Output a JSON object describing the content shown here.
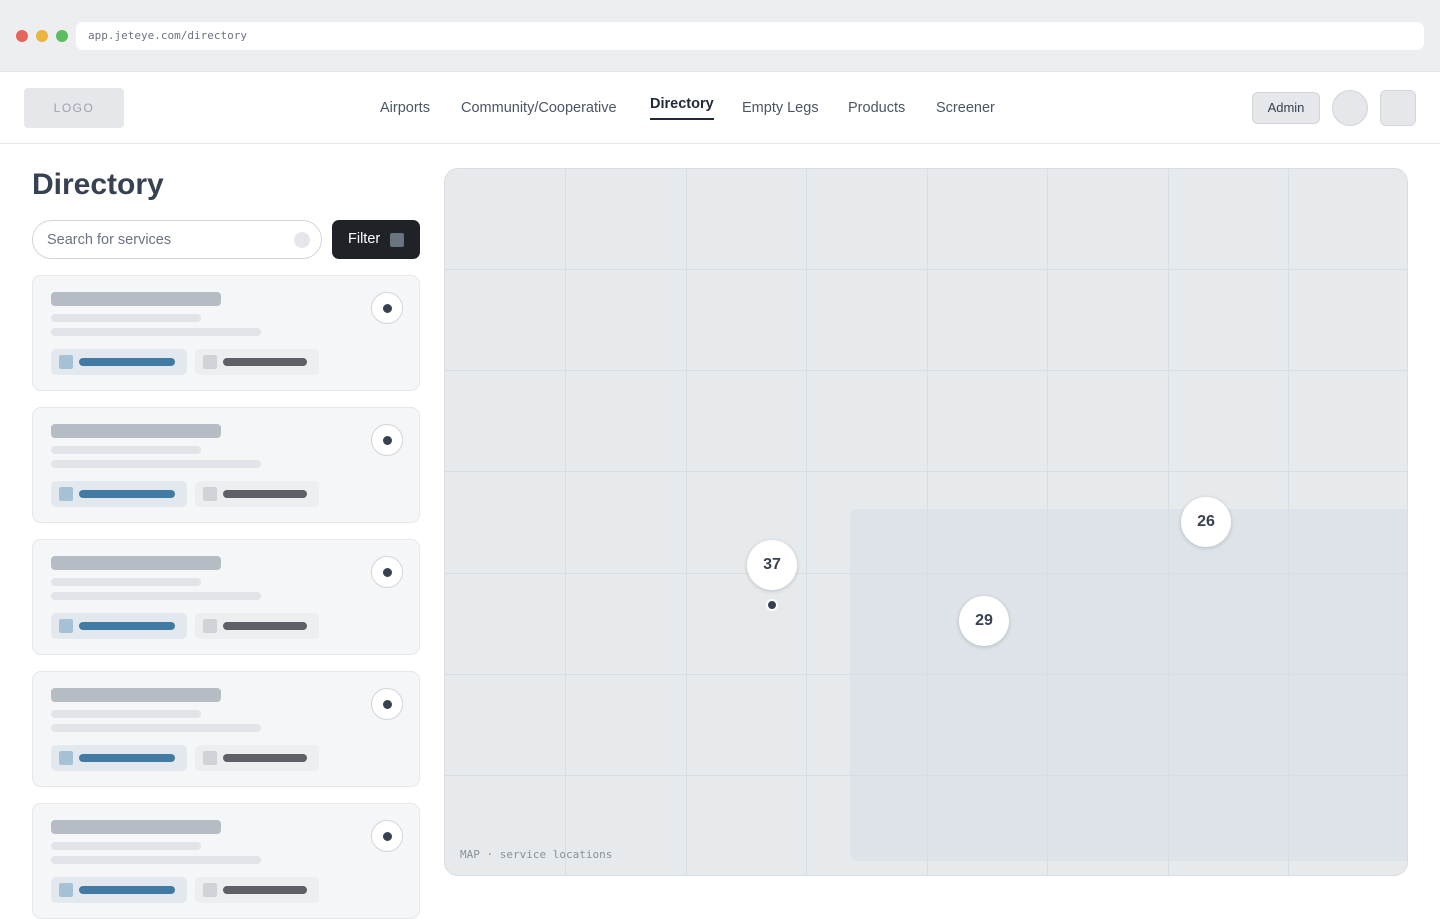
{
  "browser": {
    "url": "app.jeteye.com/directory"
  },
  "header": {
    "logo_text": "LOGO",
    "nav": [
      {
        "label": "Airports",
        "active": false
      },
      {
        "label": "Community/Cooperative",
        "active": false
      },
      {
        "label": "Directory",
        "active": true
      },
      {
        "label": "Empty Legs",
        "active": false
      },
      {
        "label": "Products",
        "active": false
      },
      {
        "label": "Screener",
        "active": false
      }
    ],
    "admin_label": "Admin"
  },
  "page": {
    "title": "Directory"
  },
  "search": {
    "placeholder": "Search for services",
    "filter_label": "Filter"
  },
  "cards": [
    {
      "state": "loading"
    },
    {
      "state": "loading"
    },
    {
      "state": "loading"
    },
    {
      "state": "loading"
    },
    {
      "state": "loading"
    }
  ],
  "map": {
    "caption": "MAP · service locations",
    "clusters": [
      {
        "count": "37"
      },
      {
        "count": "26"
      },
      {
        "count": "29"
      }
    ]
  },
  "colors": {
    "accent_dark": "#1f2328",
    "chip_accent": "#417aa2",
    "map_background": "#e6eaec"
  },
  "icons": [
    "search-icon",
    "filter-icon",
    "location-pin-icon"
  ]
}
